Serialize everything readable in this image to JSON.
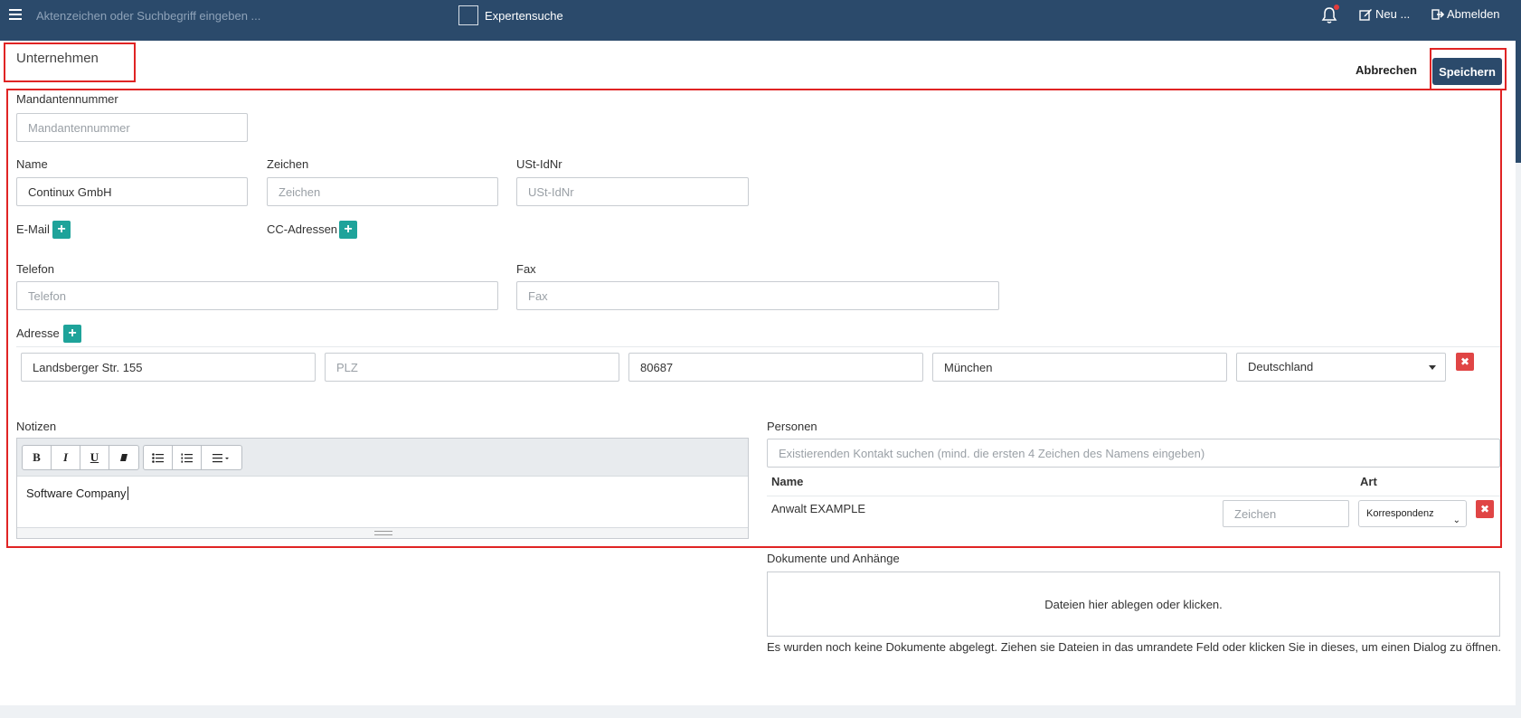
{
  "topbar": {
    "search_placeholder": "Aktenzeichen oder Suchbegriff eingeben ...",
    "expert_search_label": "Expertensuche",
    "new_label": "Neu ...",
    "logout_label": "Abmelden"
  },
  "header": {
    "title": "Unternehmen",
    "cancel_label": "Abbrechen",
    "save_label": "Speichern"
  },
  "form": {
    "client_number": {
      "label": "Mandantennummer",
      "placeholder": "Mandantennummer",
      "value": ""
    },
    "name": {
      "label": "Name",
      "value": "Continux GmbH"
    },
    "sign": {
      "label": "Zeichen",
      "placeholder": "Zeichen",
      "value": ""
    },
    "vat": {
      "label": "USt-IdNr",
      "placeholder": "USt-IdNr",
      "value": ""
    },
    "email_label": "E-Mail",
    "cc_label": "CC-Adressen",
    "phone": {
      "label": "Telefon",
      "placeholder": "Telefon",
      "value": ""
    },
    "fax": {
      "label": "Fax",
      "placeholder": "Fax",
      "value": ""
    },
    "address": {
      "label": "Adresse",
      "street": "Landsberger Str. 155",
      "plz_placeholder": "PLZ",
      "plz": "",
      "zip": "80687",
      "city": "München",
      "country": "Deutschland"
    }
  },
  "notes": {
    "label": "Notizen",
    "content": "Software Company"
  },
  "persons": {
    "label": "Personen",
    "search_placeholder": "Existierenden Kontakt suchen (mind. die ersten 4 Zeichen des Namens eingeben)",
    "col_name": "Name",
    "col_type": "Art",
    "rows": [
      {
        "name": "Anwalt EXAMPLE",
        "sign_placeholder": "Zeichen",
        "type": "Korrespondenz"
      }
    ]
  },
  "documents": {
    "label": "Dokumente und Anhänge",
    "drop_text": "Dateien hier ablegen oder klicken.",
    "note": "Es wurden noch keine Dokumente abgelegt. Ziehen sie Dateien in das umrandete Feld oder klicken Sie in dieses, um einen Dialog zu öffnen."
  },
  "colors": {
    "navy": "#2b4a6b",
    "teal": "#1ea39a",
    "danger": "#e04545",
    "highlight": "#e02424"
  }
}
